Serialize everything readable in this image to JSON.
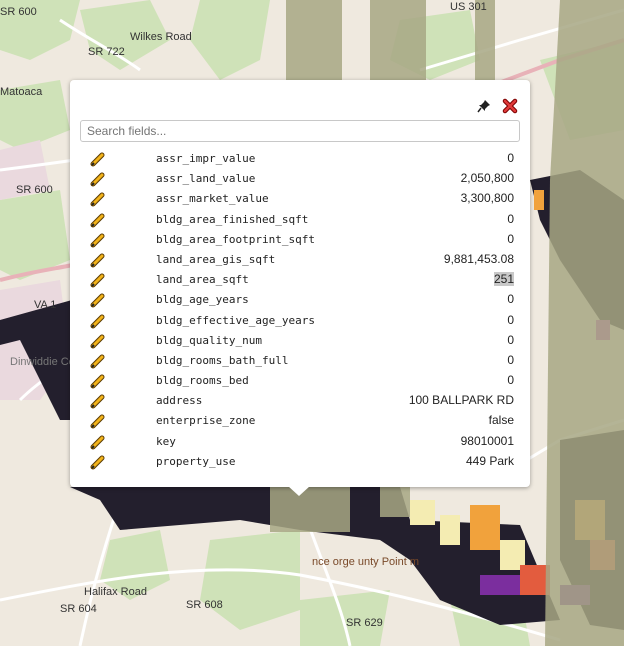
{
  "map": {
    "road_labels": [
      "SR 600",
      "SR 722",
      "SR 600",
      "VA 1",
      "SR 608",
      "SR 604",
      "SR 629",
      "US 301",
      "Dinwiddie Cou",
      "Halifax Road",
      "Matoaca",
      "Wilkes Road",
      "nce orge unty Point m"
    ]
  },
  "popup": {
    "pin_icon": "pin-icon",
    "close_icon": "close-icon",
    "search_placeholder": "Search fields...",
    "fields": [
      {
        "name": "assr_impr_value",
        "value": "0"
      },
      {
        "name": "assr_land_value",
        "value": "2,050,800"
      },
      {
        "name": "assr_market_value",
        "value": "3,300,800"
      },
      {
        "name": "bldg_area_finished_sqft",
        "value": "0"
      },
      {
        "name": "bldg_area_footprint_sqft",
        "value": "0"
      },
      {
        "name": "land_area_gis_sqft",
        "value": "9,881,453.08"
      },
      {
        "name": "land_area_sqft",
        "value": "251"
      },
      {
        "name": "bldg_age_years",
        "value": "0"
      },
      {
        "name": "bldg_effective_age_years",
        "value": "0"
      },
      {
        "name": "bldg_quality_num",
        "value": "0"
      },
      {
        "name": "bldg_rooms_bath_full",
        "value": "0"
      },
      {
        "name": "bldg_rooms_bed",
        "value": "0"
      },
      {
        "name": "address",
        "value": "100 BALLPARK RD"
      },
      {
        "name": "enterprise_zone",
        "value": "false"
      },
      {
        "name": "key",
        "value": "98010001"
      },
      {
        "name": "property_use",
        "value": "449 Park"
      }
    ]
  }
}
